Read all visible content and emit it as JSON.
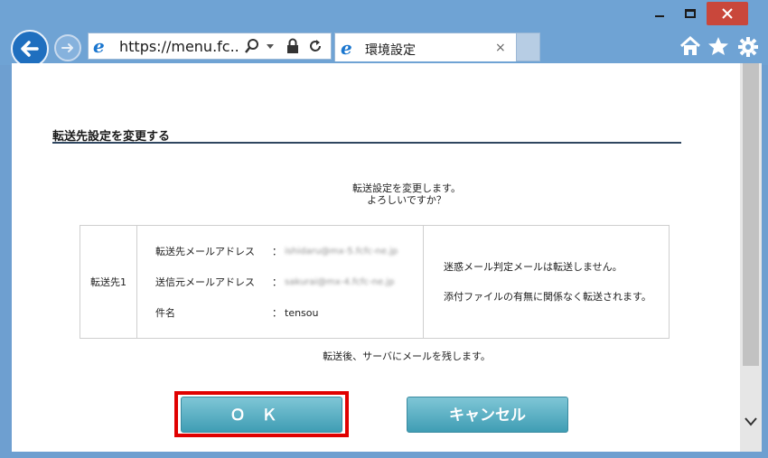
{
  "browser": {
    "address": "https://menu.fc...",
    "tab_title": "環境設定",
    "tab_close": "×",
    "ie_glyph": "e"
  },
  "page": {
    "section_title": "転送先設定を変更する",
    "confirm_line1": "転送設定を変更します。",
    "confirm_line2": "よろしいですか？",
    "forward": {
      "label": "転送先1",
      "fields": [
        {
          "name": "転送先メールアドレス",
          "colon": "：",
          "value": "ishidaru@mx-5.fcfc-ne.jp"
        },
        {
          "name": "送信元メールアドレス",
          "colon": "：",
          "value": "sakurai@mx-4.fcfc-ne.jp"
        },
        {
          "name": "件名",
          "colon": "：",
          "value": "tensou"
        }
      ],
      "note1": "迷惑メール判定メールは転送しません。",
      "note2": "添付ファイルの有無に関係なく転送されます。"
    },
    "after_note": "転送後、サーバにメールを残します。",
    "ok_label": "ＯＫ",
    "cancel_label": "キャンセル"
  },
  "colors": {
    "frame": "#6fa3d4",
    "button": "#4fa9be",
    "highlight": "#e00000"
  }
}
